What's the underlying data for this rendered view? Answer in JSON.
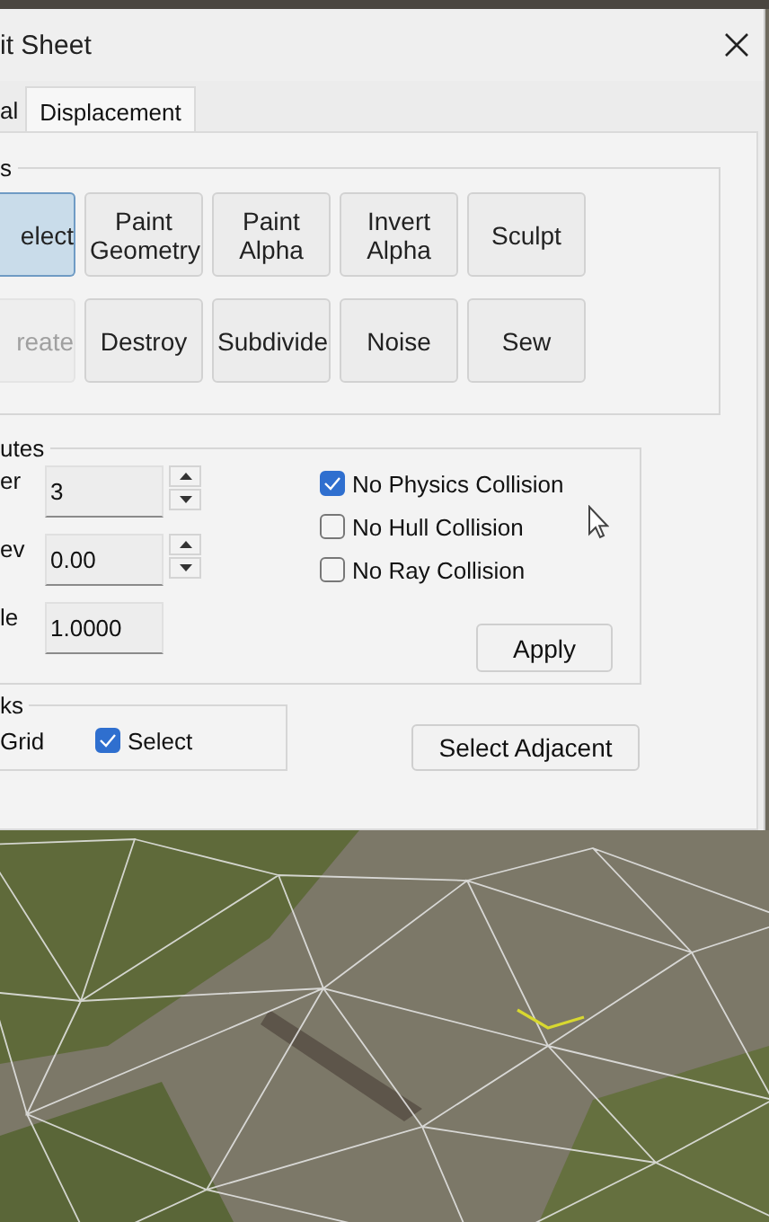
{
  "window": {
    "title": "it Sheet"
  },
  "tabs": [
    {
      "label": "al",
      "selected": false
    },
    {
      "label": "Displacement",
      "selected": true
    }
  ],
  "tools_group": {
    "label": "s",
    "rows": [
      [
        {
          "label": "elect",
          "selected": true,
          "disabled": false
        },
        {
          "label": "Paint Geometry",
          "selected": false,
          "disabled": false
        },
        {
          "label": "Paint Alpha",
          "selected": false,
          "disabled": false
        },
        {
          "label": "Invert Alpha",
          "selected": false,
          "disabled": false
        },
        {
          "label": "Sculpt",
          "selected": false,
          "disabled": false
        }
      ],
      [
        {
          "label": "reate",
          "selected": false,
          "disabled": true
        },
        {
          "label": "Destroy",
          "selected": false,
          "disabled": false
        },
        {
          "label": "Subdivide",
          "selected": false,
          "disabled": false
        },
        {
          "label": "Noise",
          "selected": false,
          "disabled": false
        },
        {
          "label": "Sew",
          "selected": false,
          "disabled": false
        }
      ]
    ]
  },
  "attributes_group": {
    "label": "utes",
    "fields": [
      {
        "label": "er",
        "value": "3",
        "kind": "spin"
      },
      {
        "label": "ev",
        "value": "0.00",
        "kind": "spin"
      },
      {
        "label": "le",
        "value": "1.0000",
        "kind": "plain"
      }
    ],
    "checkboxes": [
      {
        "label": "No Physics Collision",
        "checked": true
      },
      {
        "label": "No Hull Collision",
        "checked": false
      },
      {
        "label": "No Ray Collision",
        "checked": false
      }
    ],
    "apply_button": "Apply"
  },
  "checks_group": {
    "label": "ks",
    "grid_label": "Grid",
    "checkbox": {
      "label": "Select",
      "checked": true
    }
  },
  "select_adjacent_button": "Select Adjacent"
}
